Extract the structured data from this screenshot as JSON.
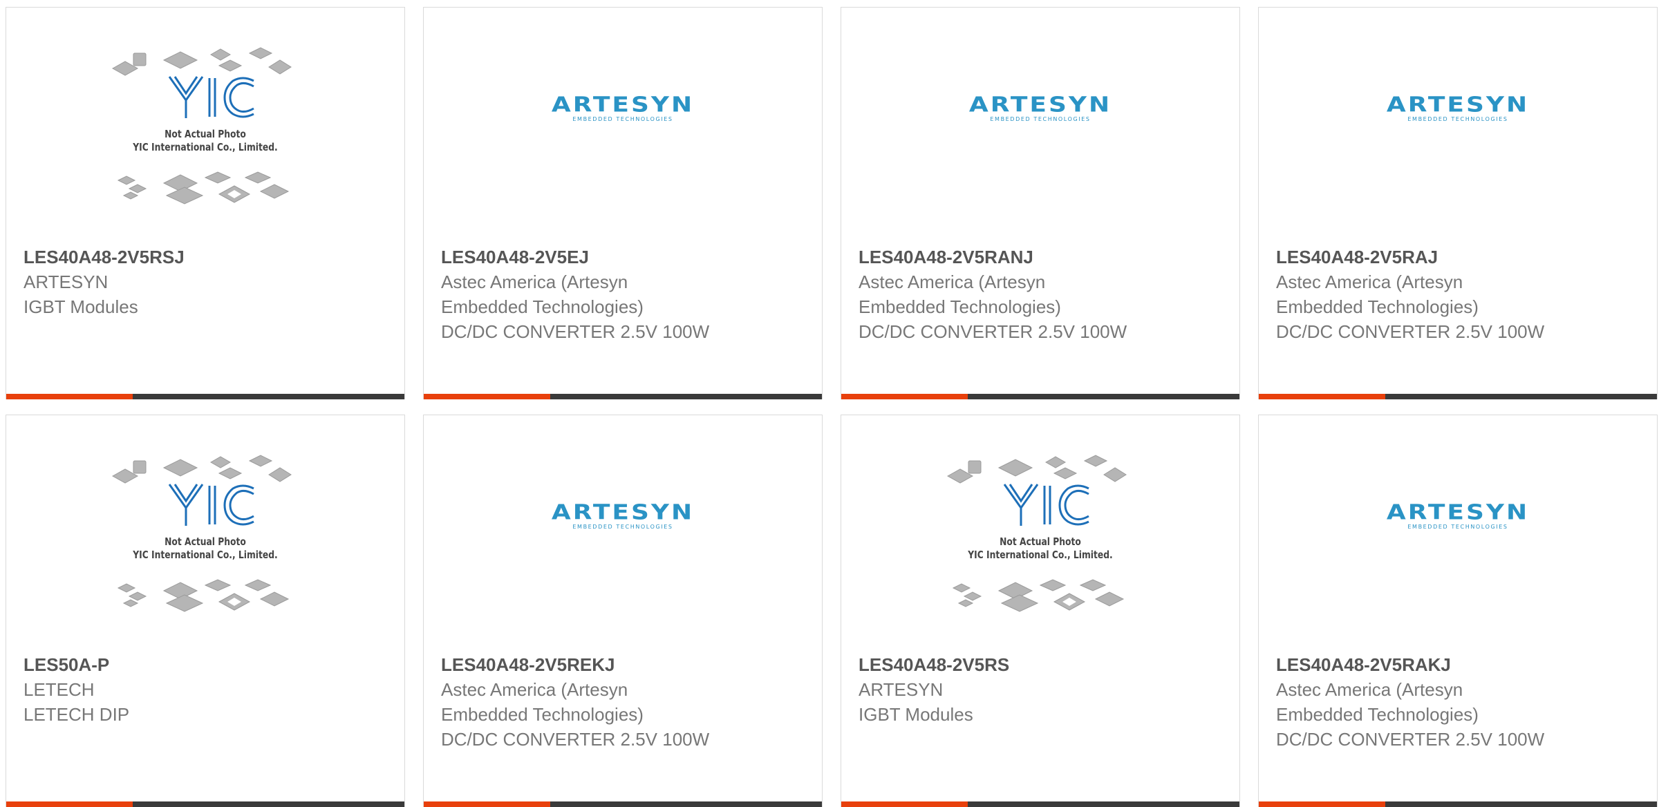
{
  "placeholder": {
    "brand": "YIC",
    "line1": "Not Actual Photo",
    "line2": "YIC International Co., Limited."
  },
  "logo": {
    "word": "ARTESYN",
    "sub": "EMBEDDED TECHNOLOGIES"
  },
  "colors": {
    "accent": "#e8400c",
    "bar": "#3a3a3a",
    "logo": "#2a93c5",
    "yic": "#1d6fb8"
  },
  "products": [
    {
      "part": "LES40A48-2V5RSJ",
      "manufacturer": "ARTESYN",
      "description": "IGBT Modules",
      "image": "placeholder"
    },
    {
      "part": "LES40A48-2V5EJ",
      "manufacturer": "Astec America (Artesyn Embedded Technologies)",
      "description": "DC/DC CONVERTER 2.5V 100W",
      "image": "artesyn-logo"
    },
    {
      "part": "LES40A48-2V5RANJ",
      "manufacturer": "Astec America (Artesyn Embedded Technologies)",
      "description": "DC/DC CONVERTER 2.5V 100W",
      "image": "artesyn-logo"
    },
    {
      "part": "LES40A48-2V5RAJ",
      "manufacturer": "Astec America (Artesyn Embedded Technologies)",
      "description": "DC/DC CONVERTER 2.5V 100W",
      "image": "artesyn-logo"
    },
    {
      "part": "LES50A-P",
      "manufacturer": "LETECH",
      "description": "LETECH DIP",
      "image": "placeholder"
    },
    {
      "part": "LES40A48-2V5REKJ",
      "manufacturer": "Astec America (Artesyn Embedded Technologies)",
      "description": "DC/DC CONVERTER 2.5V 100W",
      "image": "artesyn-logo"
    },
    {
      "part": "LES40A48-2V5RS",
      "manufacturer": "ARTESYN",
      "description": "IGBT Modules",
      "image": "placeholder"
    },
    {
      "part": "LES40A48-2V5RAKJ",
      "manufacturer": "Astec America (Artesyn Embedded Technologies)",
      "description": "DC/DC CONVERTER 2.5V 100W",
      "image": "artesyn-logo"
    }
  ]
}
